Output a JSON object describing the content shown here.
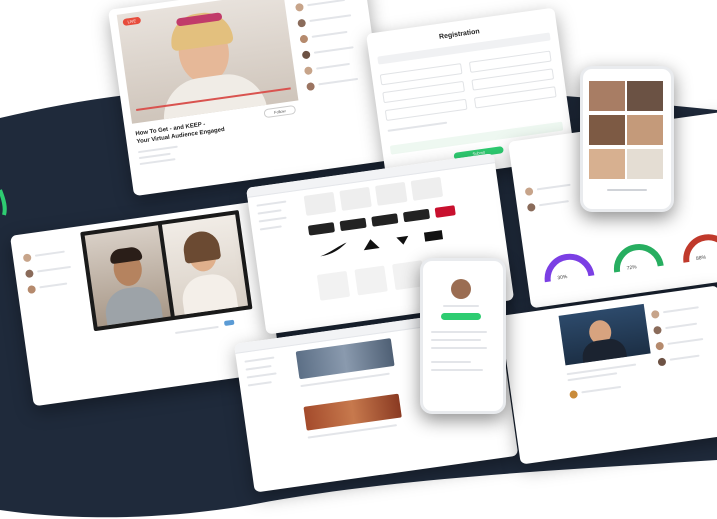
{
  "colors": {
    "navy": "#1f2a3b",
    "accent_green": "#2ecc71",
    "live_red": "#e74c3c",
    "purple": "#7b3fe4",
    "gauge_green": "#27ae60",
    "gauge_red": "#c0392b"
  },
  "video_card": {
    "live_badge": "LIVE",
    "title": "How To Get - and KEEP -",
    "subtitle": "Your Virtual Audience Engaged",
    "follow_label": "Follow"
  },
  "registration": {
    "title": "Registration",
    "submit_label": "Submit"
  },
  "gauges": {
    "values": [
      "30%",
      "72%",
      "88%"
    ]
  }
}
